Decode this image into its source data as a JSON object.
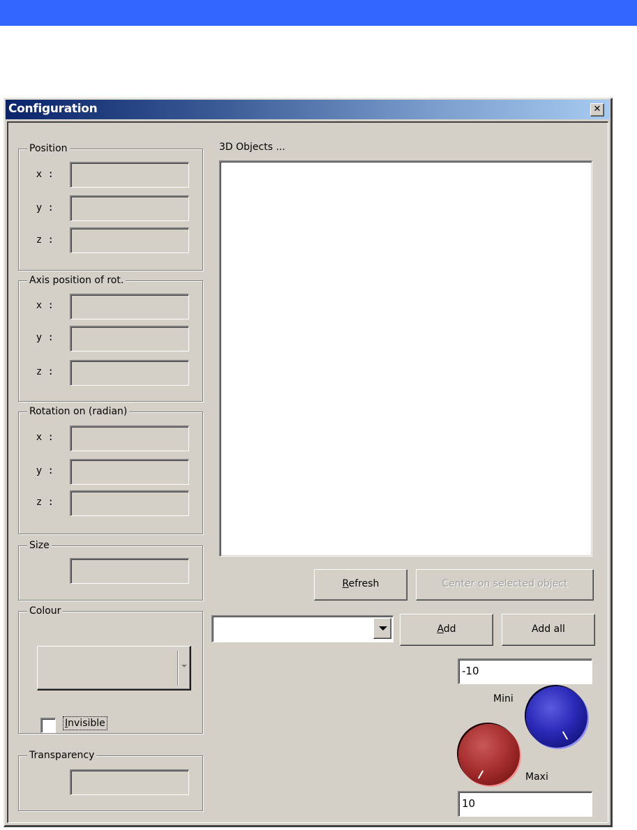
{
  "window": {
    "title": "Configuration",
    "close_symbol": "✕"
  },
  "groups": {
    "position": {
      "label": "Position",
      "fields": [
        {
          "axis": "x :",
          "value": ""
        },
        {
          "axis": "y :",
          "value": ""
        },
        {
          "axis": "z :",
          "value": ""
        }
      ]
    },
    "axis_rotation": {
      "label": "Axis position of rot.",
      "fields": [
        {
          "axis": "x :",
          "value": ""
        },
        {
          "axis": "y :",
          "value": ""
        },
        {
          "axis": "z :",
          "value": ""
        }
      ]
    },
    "rotation": {
      "label": "Rotation on (radian)",
      "fields": [
        {
          "axis": "x :",
          "value": ""
        },
        {
          "axis": "y :",
          "value": ""
        },
        {
          "axis": "z :",
          "value": ""
        }
      ]
    },
    "size": {
      "label": "Size",
      "value": ""
    },
    "colour": {
      "label": "Colour",
      "selected": ""
    },
    "invisible": {
      "label_prefix": "",
      "label_accel": "I",
      "label_rest": "nvisible",
      "checked": false
    },
    "transparency": {
      "label": "Transparency",
      "value": ""
    }
  },
  "objects": {
    "title": "3D Objects ...",
    "items": []
  },
  "buttons": {
    "refresh": {
      "accel": "R",
      "rest": "efresh"
    },
    "center": {
      "label": "Center on selected object",
      "disabled": true
    },
    "add": {
      "accel": "A",
      "rest": "dd"
    },
    "add_all": {
      "label": "Add all"
    }
  },
  "object_combo": {
    "selected": ""
  },
  "range": {
    "min_value": "-10",
    "max_value": "10",
    "min_label": "Mini",
    "max_label": "Maxi",
    "min_knob_color": "#2a2ab8",
    "max_knob_color": "#a83030"
  }
}
